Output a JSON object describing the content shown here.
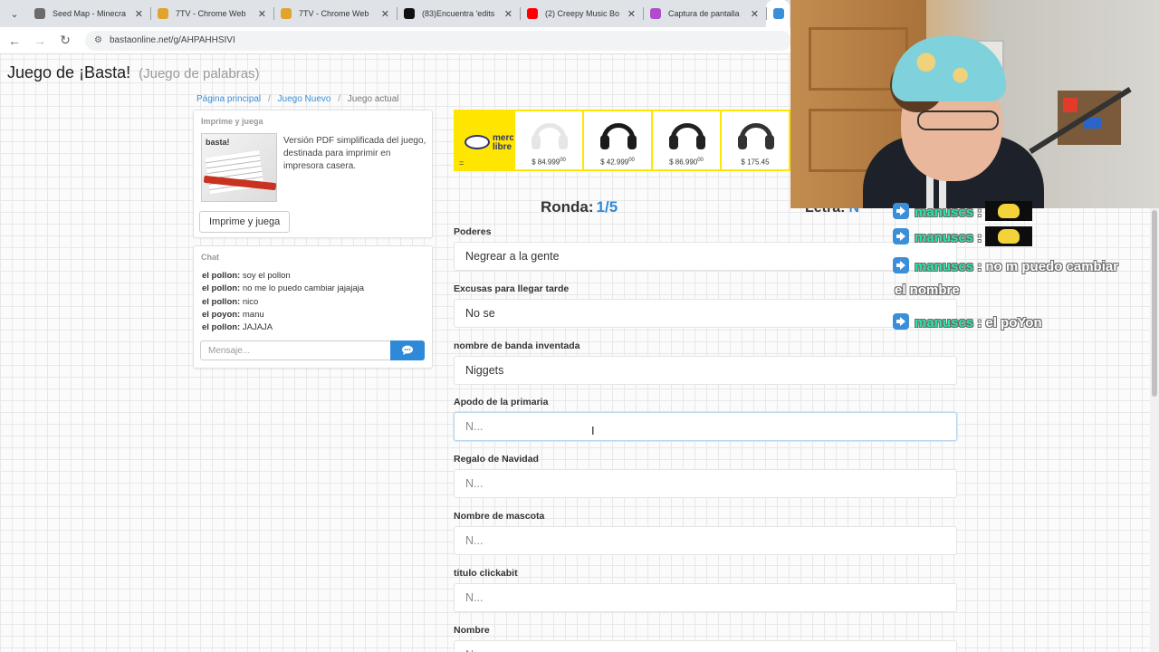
{
  "browser": {
    "tabs": [
      {
        "title": "Seed Map - Minecra",
        "favicon_color": "#6b6b6b",
        "close": "✕"
      },
      {
        "title": "7TV - Chrome Web",
        "favicon_color": "#e0a32e",
        "close": "✕"
      },
      {
        "title": "7TV - Chrome Web",
        "favicon_color": "#e0a32e",
        "close": "✕"
      },
      {
        "title": "(83)Encuentra 'edits",
        "favicon_color": "#111111",
        "close": "✕"
      },
      {
        "title": "(2) Creepy Music Bo",
        "favicon_color": "#ff0000",
        "close": "✕"
      },
      {
        "title": "Captura de pantalla",
        "favicon_color": "#b04cc9",
        "close": "✕"
      },
      {
        "title": "¡",
        "favicon_color": "#3a8fd8",
        "close": ""
      }
    ],
    "url": "bastaonline.net/g/AHPAHHSIVI"
  },
  "header": {
    "title": "Juego de ¡Basta!",
    "subtitle": "(Juego de palabras)"
  },
  "breadcrumb": {
    "home": "Página principal",
    "new_game": "Juego Nuevo",
    "current": "Juego actual"
  },
  "print_panel": {
    "heading": "Imprime y juega",
    "description": "Versión PDF simplificada del juego, destinada para imprimir en impresora casera.",
    "button": "Imprime y juega",
    "thumb_logo": "basta!"
  },
  "chat": {
    "heading": "Chat",
    "messages": [
      {
        "author": "el pollon:",
        "text": "soy el pollon"
      },
      {
        "author": "el pollon:",
        "text": "no me lo puedo cambiar jajajaja"
      },
      {
        "author": "el pollon:",
        "text": "nico"
      },
      {
        "author": "el poyon:",
        "text": "manu"
      },
      {
        "author": "el pollon:",
        "text": "JAJAJA"
      }
    ],
    "input_placeholder": "Mensaje..."
  },
  "ad": {
    "brand": "mercado libre",
    "mark": "=",
    "items": [
      {
        "price": "$ 84.999",
        "cents": "00",
        "product_color": "#e6e6e6"
      },
      {
        "price": "$ 42.999",
        "cents": "00",
        "product_color": "#1b1b1b"
      },
      {
        "price": "$ 86.990",
        "cents": "00",
        "product_color": "#222222"
      },
      {
        "price": "$ 175.45",
        "cents": "",
        "product_color": "#333333"
      }
    ]
  },
  "game": {
    "ronda_label": "Ronda:",
    "ronda_value": "1/5",
    "letra_label": "Letra:",
    "letra_value": "N",
    "fields": [
      {
        "label": "Poderes",
        "value": "Negrear a la gente",
        "placeholder": "N..."
      },
      {
        "label": "Excusas para llegar tarde",
        "value": "No se",
        "placeholder": "N..."
      },
      {
        "label": "nombre de banda inventada",
        "value": "Niggets",
        "placeholder": "N..."
      },
      {
        "label": "Apodo de la primaria",
        "value": "",
        "placeholder": "N..."
      },
      {
        "label": "Regalo de Navidad",
        "value": "",
        "placeholder": "N..."
      },
      {
        "label": "Nombre de mascota",
        "value": "",
        "placeholder": "N..."
      },
      {
        "label": "titulo clickabit",
        "value": "",
        "placeholder": "N..."
      },
      {
        "label": "Nombre",
        "value": "",
        "placeholder": "N..."
      }
    ]
  },
  "stream_chat": [
    {
      "user": "manuscs",
      "text": ":",
      "emote": true
    },
    {
      "user": "manuscs",
      "text": ":",
      "emote": true
    },
    {
      "user": "manuscs",
      "text": ": no m puedo cambiar",
      "emote": false,
      "continuation": "el nombre"
    },
    {
      "user": "manuscs",
      "text": ": el poYon",
      "emote": false
    }
  ],
  "colors": {
    "accent": "#2e8ad8",
    "ad_yellow": "#ffe600",
    "overlay_user": "#2ee3a7"
  }
}
